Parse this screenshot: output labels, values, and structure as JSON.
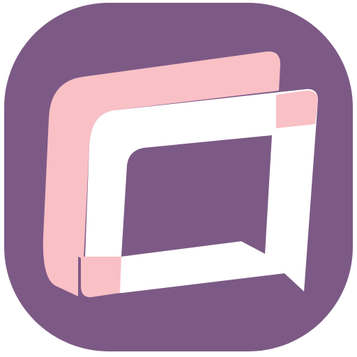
{
  "icon": {
    "name": "chat-bubble-app-icon",
    "colors": {
      "background": "#7d5a86",
      "back_bubble": "#f9c0c6",
      "front_bubble": "#ffffff",
      "overlap": "#f9c0c6"
    }
  }
}
